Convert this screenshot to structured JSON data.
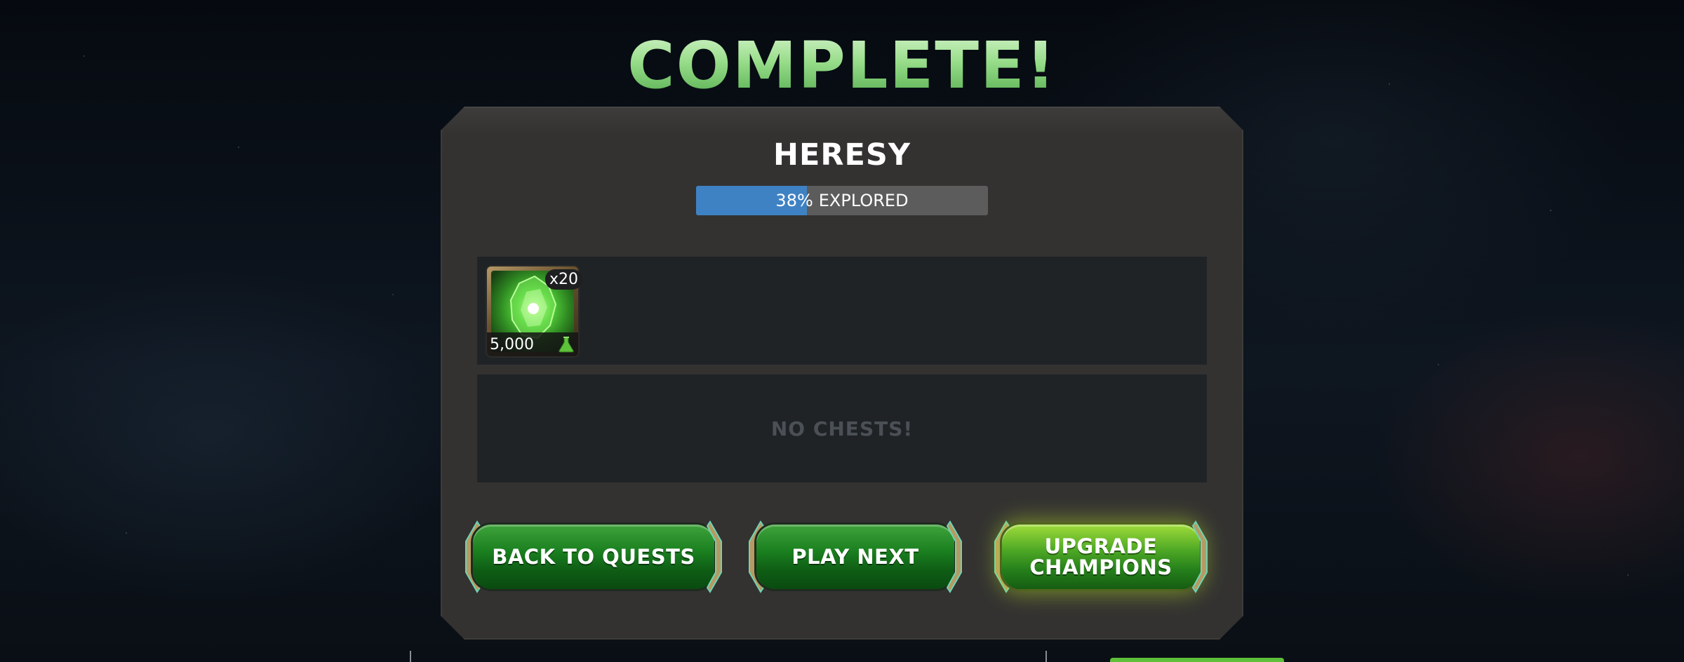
{
  "screen": {
    "title": "COMPLETE!"
  },
  "quest": {
    "name": "HERESY",
    "explored_percent": 38,
    "explored_percent_label": "38%",
    "explored_label": "EXPLORED"
  },
  "rewards": [
    {
      "item_icon": "green-catalyst-icon",
      "quantity_label": "x20",
      "amount_label": "5,000",
      "currency_icon": "flask-icon"
    }
  ],
  "chests": {
    "empty_message": "NO CHESTS!"
  },
  "buttons": {
    "back_to_quests": "BACK TO QUESTS",
    "play_next": "PLAY NEXT",
    "upgrade_champions_line1": "UPGRADE",
    "upgrade_champions_line2": "CHAMPIONS"
  },
  "colors": {
    "title_green": "#98dd8a",
    "progress_fill": "#3f82c4",
    "progress_track": "#5c5c5c",
    "button_green": "#1a7f1f",
    "button_glow": "#9fdc3a"
  }
}
